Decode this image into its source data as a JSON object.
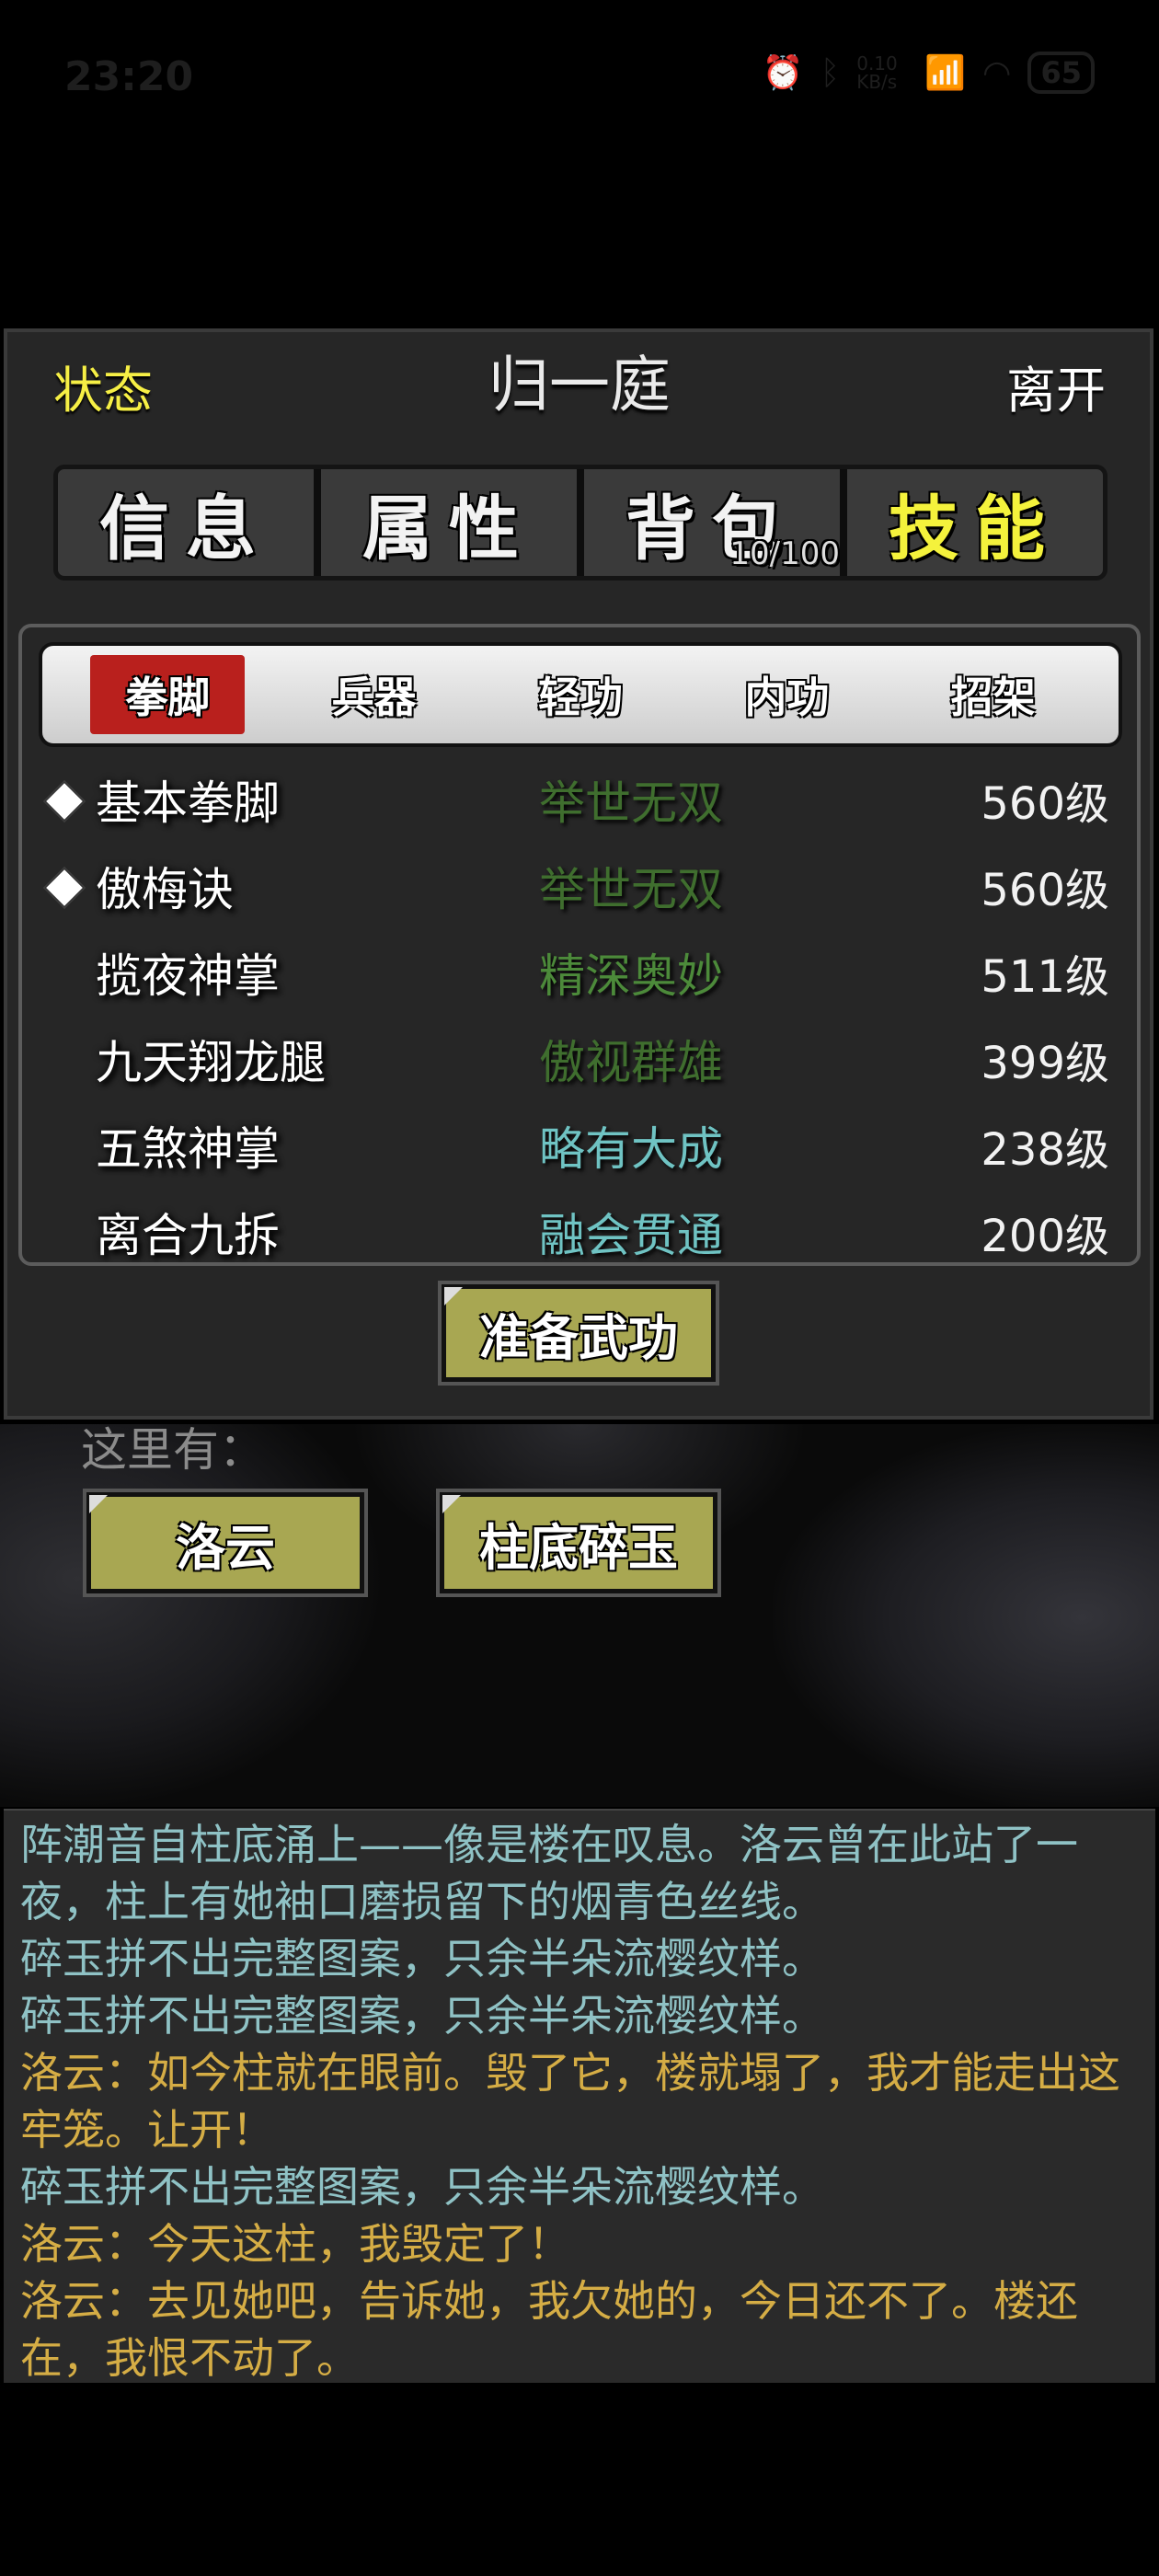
{
  "status_bar": {
    "time": "23:20",
    "net_speed": "0.10 KB/s",
    "signal": "5G",
    "battery": "65"
  },
  "header": {
    "left": "状态",
    "title": "归一庭",
    "right": "离开"
  },
  "main_tabs": [
    {
      "label": "信息",
      "active": false
    },
    {
      "label": "属性",
      "active": false
    },
    {
      "label": "背包",
      "active": false,
      "count": "10/100"
    },
    {
      "label": "技能",
      "active": true
    }
  ],
  "sub_tabs": [
    {
      "label": "拳脚",
      "active": true
    },
    {
      "label": "兵器",
      "active": false
    },
    {
      "label": "轻功",
      "active": false
    },
    {
      "label": "内功",
      "active": false
    },
    {
      "label": "招架",
      "active": false
    }
  ],
  "skills": [
    {
      "name": "基本拳脚",
      "grade": "举世无双",
      "level": "560级",
      "marked": true,
      "grade_color": "#3f6e2e"
    },
    {
      "name": "傲梅诀",
      "grade": "举世无双",
      "level": "560级",
      "marked": true,
      "grade_color": "#3f6e2e"
    },
    {
      "name": "揽夜神掌",
      "grade": "精深奥妙",
      "level": "511级",
      "marked": false,
      "grade_color": "#4c8a3a"
    },
    {
      "name": "九天翔龙腿",
      "grade": "傲视群雄",
      "level": "399级",
      "marked": false,
      "grade_color": "#3f6e2e"
    },
    {
      "name": "五煞神掌",
      "grade": "略有大成",
      "level": "238级",
      "marked": false,
      "grade_color": "#6fc3c3"
    },
    {
      "name": "离合九拆",
      "grade": "融会贯通",
      "level": "200级",
      "marked": false,
      "grade_color": "#6fc3c3"
    }
  ],
  "prepare_button": "准备武功",
  "scene": {
    "here_label": "这里有：",
    "npcs": [
      "洛云",
      "柱底碎玉"
    ]
  },
  "log": [
    {
      "type": "narr",
      "text": "阵潮音自柱底涌上——像是楼在叹息。洛云曾在此站了一夜，柱上有她袖口磨损留下的烟青色丝线。"
    },
    {
      "type": "narr",
      "text": "碎玉拼不出完整图案，只余半朵流樱纹样。"
    },
    {
      "type": "narr",
      "text": "碎玉拼不出完整图案，只余半朵流樱纹样。"
    },
    {
      "type": "say",
      "text": "洛云：如今柱就在眼前。毁了它，楼就塌了，我才能走出这牢笼。让开！"
    },
    {
      "type": "narr",
      "text": "碎玉拼不出完整图案，只余半朵流樱纹样。"
    },
    {
      "type": "say",
      "text": "洛云：今天这柱，我毁定了！"
    },
    {
      "type": "say",
      "text": "洛云：去见她吧，告诉她，我欠她的，今日还不了。楼还在，我恨不动了。"
    }
  ],
  "colors": {
    "active_tab": "#f4f23c",
    "active_subtab": "#b9201d",
    "button": "#a8a752",
    "narration": "#8fc2c5",
    "dialogue": "#d5ad45"
  }
}
